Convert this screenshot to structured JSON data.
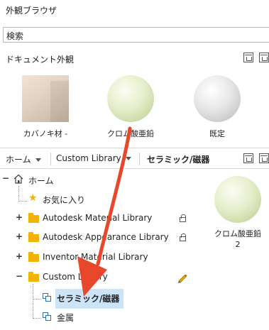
{
  "window": {
    "title": "外観ブラウザ"
  },
  "search": {
    "value": "検索"
  },
  "document": {
    "label": "ドキュメント外観",
    "materials": [
      {
        "label": "カバノキ材 -",
        "thumb": "wood-cube"
      },
      {
        "label": "クロム酸亜鉛",
        "thumb": "green-sphere"
      },
      {
        "label": "既定",
        "thumb": "white-sphere"
      }
    ]
  },
  "library_bar": {
    "home": "ホーム",
    "library": "Custom Library",
    "current": "セラミック/磁器"
  },
  "tree": {
    "home": "ホーム",
    "favorites": "お気に入り",
    "items": [
      {
        "expander": "+",
        "label": "Autodesk Material Library",
        "locked": true
      },
      {
        "expander": "+",
        "label": "Autodesk Appearance Library",
        "locked": true
      },
      {
        "expander": "+",
        "label": "Inventor Material Library",
        "locked": false
      },
      {
        "expander": "−",
        "label": "Custom Library",
        "locked": false
      }
    ],
    "children": [
      {
        "label": "セラミック/磁器",
        "selected": true
      },
      {
        "label": "金属",
        "selected": false
      }
    ]
  },
  "content": {
    "materials": [
      {
        "label": "クロム酸亜鉛 2",
        "thumb": "green-sphere"
      }
    ]
  },
  "colors": {
    "accent": "#e8472b",
    "selection": "#cce4f7",
    "folder": "#f2b200"
  }
}
